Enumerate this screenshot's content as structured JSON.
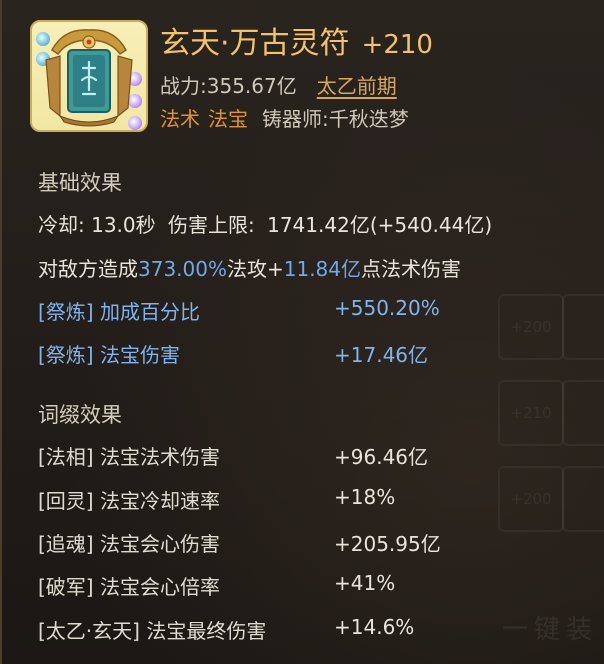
{
  "item": {
    "name": "玄天·万古灵符",
    "plus_level": "+210",
    "power_label": "战力:",
    "power_value": "355.67亿",
    "realm": "太乙前期",
    "tag1": "法术",
    "tag2": "法宝",
    "maker_label": "铸器师:",
    "maker_name": "千秋迭梦"
  },
  "basic": {
    "title": "基础效果",
    "cooldown_label": "冷却:",
    "cooldown_value": "13.0秒",
    "damage_cap_label": "伤害上限:",
    "damage_cap_value": "1741.42亿(+540.44亿)",
    "desc_prefix": "对敌方造成",
    "desc_pct": "373.00%",
    "desc_mid": "法攻+",
    "desc_flat": "11.84亿",
    "desc_suffix": "点法术伤害",
    "refine": [
      {
        "label": "[祭炼] 加成百分比",
        "value": "+550.20%"
      },
      {
        "label": "[祭炼] 法宝伤害",
        "value": "+17.46亿"
      }
    ]
  },
  "affixes": {
    "title": "词缀效果",
    "items": [
      {
        "label": "[法相] 法宝法术伤害",
        "value": "+96.46亿"
      },
      {
        "label": "[回灵] 法宝冷却速率",
        "value": "+18%"
      },
      {
        "label": "[追魂] 法宝会心伤害",
        "value": "+205.95亿"
      },
      {
        "label": "[破军] 法宝会心倍率",
        "value": "+41%"
      },
      {
        "label": "[太乙·玄天] 法宝最终伤害",
        "value": "+14.6%"
      }
    ]
  },
  "colors": {
    "title_gold": "#f3c26a",
    "tag_orange": "#e0952e",
    "value_blue": "#7fb4ee",
    "panel_bg": "#241e1a"
  },
  "icons": [
    "talisman-artifact-icon",
    "cyan-gem-icon",
    "purple-gem-icon"
  ]
}
